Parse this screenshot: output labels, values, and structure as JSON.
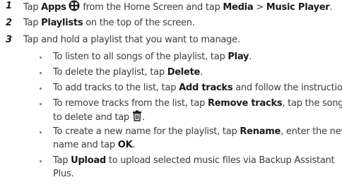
{
  "steps": [
    {
      "number": "1",
      "pre": "Tap ",
      "apps": "Apps",
      "mid": " from the Home Screen and tap ",
      "media": "Media",
      "sep": " > ",
      "music_player": "Music Player",
      "end": "."
    },
    {
      "number": "2",
      "pre": "Tap ",
      "playlists": "Playlists",
      "end": " on the top of the screen."
    },
    {
      "number": "3",
      "text": "Tap and hold a playlist that you want to manage."
    }
  ],
  "bullets": {
    "play": {
      "pre": "To listen to all songs of the playlist, tap ",
      "bold": "Play",
      "end": "."
    },
    "delete": {
      "pre": "To delete the playlist, tap ",
      "bold": "Delete",
      "end": "."
    },
    "add": {
      "pre": "To add tracks to the list, tap ",
      "bold": "Add tracks",
      "end": " and follow the instructions."
    },
    "remove": {
      "pre": "To remove tracks from the list, tap ",
      "bold": "Remove tracks",
      "end": ", tap the song(s)",
      "line2_pre": "to delete and tap ",
      "line2_end": "."
    },
    "rename": {
      "pre": "To create a new name for the playlist, tap ",
      "bold": "Rename",
      "end": ", enter the new",
      "line2_pre": "name and tap ",
      "line2_bold": "OK",
      "line2_end": "."
    },
    "upload": {
      "pre": "Tap ",
      "bold": "Upload",
      "end": " to upload selected music files via Backup Assistant",
      "line2": "Plus."
    }
  }
}
